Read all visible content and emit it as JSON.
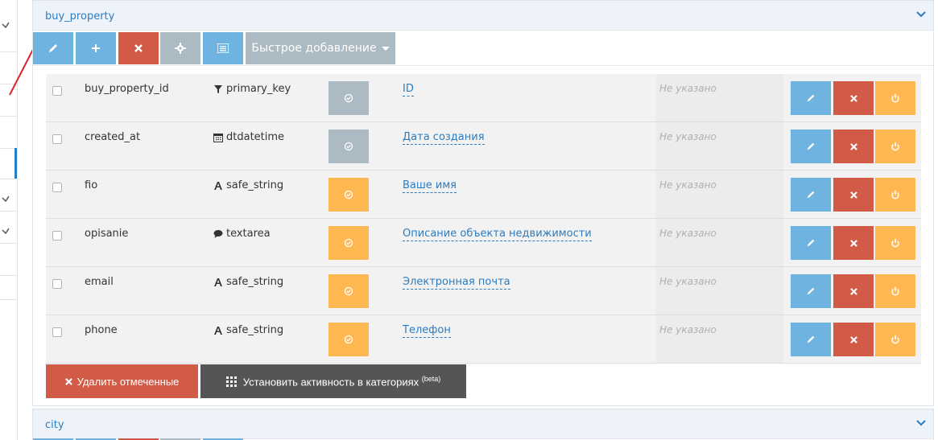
{
  "panels": [
    {
      "title": "buy_property",
      "toolbar": {
        "quick_add_label": "Быстрое добавление"
      },
      "rows": [
        {
          "name": "buy_property_id",
          "type": "primary_key",
          "type_icon": "filter-icon",
          "state": "gray",
          "label": "ID",
          "note": "Не указано"
        },
        {
          "name": "created_at",
          "type": "dtdatetime",
          "type_icon": "calendar-icon",
          "state": "gray",
          "label": "Дата создания",
          "note": "Не указано"
        },
        {
          "name": "fio",
          "type": "safe_string",
          "type_icon": "font-icon",
          "state": "orange",
          "label": "Ваше имя",
          "note": "Не указано"
        },
        {
          "name": "opisanie",
          "type": "textarea",
          "type_icon": "comment-icon",
          "state": "orange",
          "label": "Описание объекта недвижимости",
          "note": "Не указано"
        },
        {
          "name": "email",
          "type": "safe_string",
          "type_icon": "font-icon",
          "state": "orange",
          "label": "Электронная почта",
          "note": "Не указано"
        },
        {
          "name": "phone",
          "type": "safe_string",
          "type_icon": "font-icon",
          "state": "orange",
          "label": "Телефон",
          "note": "Не указано"
        }
      ],
      "footer": {
        "delete_checked_label": "Удалить отмеченные",
        "set_active_label": "Установить активность в категориях",
        "set_active_sup": "(beta)"
      }
    },
    {
      "title": "city"
    }
  ],
  "colors": {
    "blue": "#6fb3e0",
    "red": "#d15b47",
    "gray": "#abbac3",
    "orange": "#ffb752",
    "dark": "#555555",
    "link": "#2a7cc0"
  }
}
